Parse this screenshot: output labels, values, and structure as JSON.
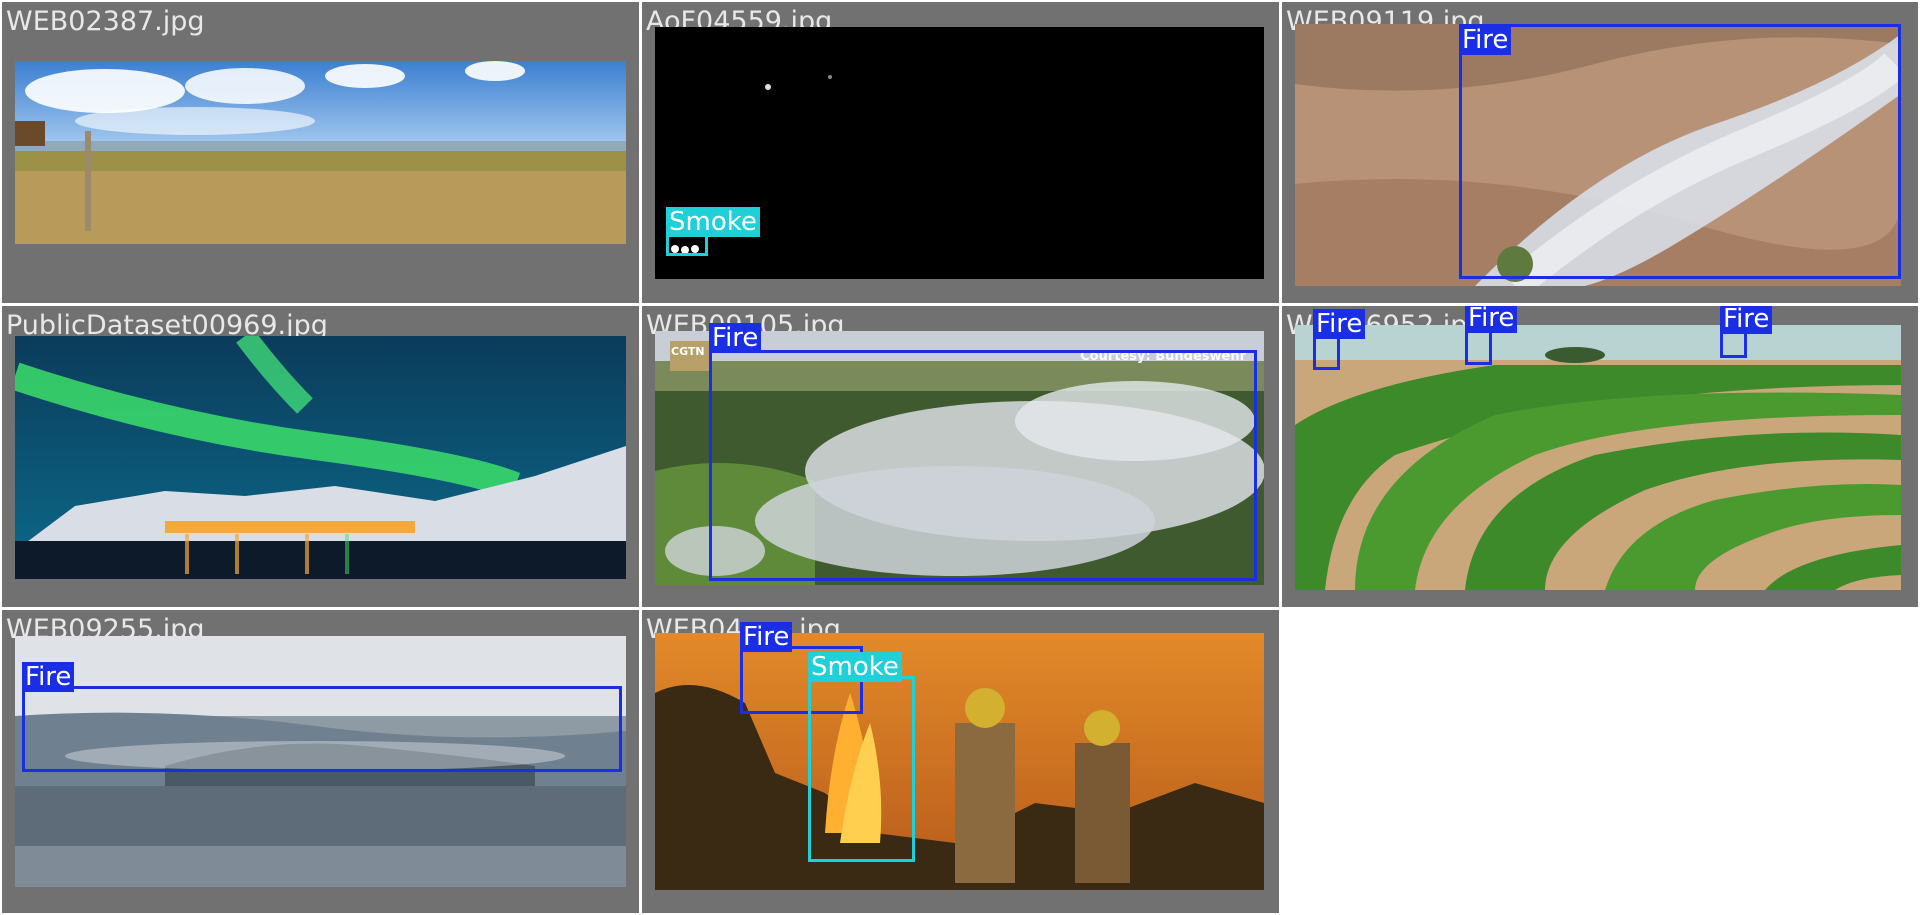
{
  "grid": {
    "cells": [
      {
        "filename": "WEB02387.jpg"
      },
      {
        "filename": "AoF04559.jpg"
      },
      {
        "filename": "WEB09119.jpg"
      },
      {
        "filename": "PublicDataset00969.jpg"
      },
      {
        "filename": "WEB09105.jpg"
      },
      {
        "filename": "WEB06952.jpg"
      },
      {
        "filename": "WEB09255.jpg"
      },
      {
        "filename": "WEB04xxx.jpg"
      }
    ]
  },
  "labels": {
    "fire": "Fire",
    "smoke": "Smoke"
  },
  "overlay_texts": {
    "courtesy": "Courtesy: Bundeswehr",
    "cgtn": "CGTN"
  },
  "colors": {
    "fire": "#1a2ee6",
    "smoke": "#1fd0d8",
    "tile_bg": "#717171"
  }
}
